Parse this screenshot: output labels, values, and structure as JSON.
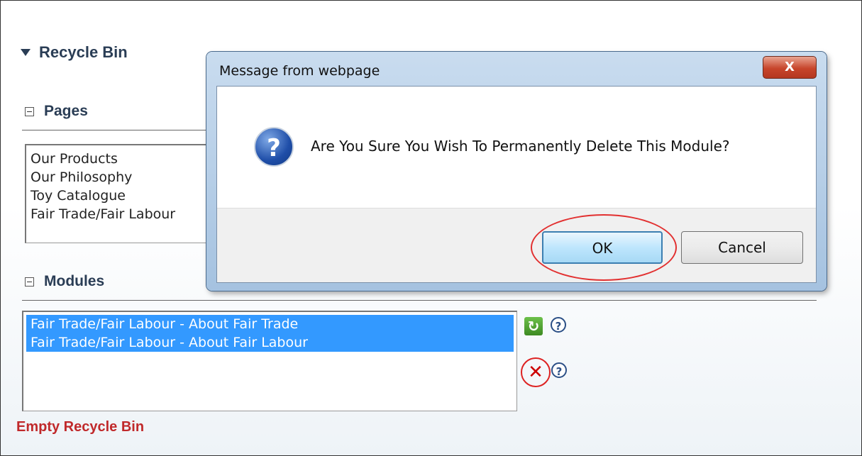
{
  "recycle_bin": {
    "title": "Recycle Bin",
    "pages": {
      "heading": "Pages",
      "items": [
        "Our Products",
        "Our Philosophy",
        "Toy Catalogue",
        "Fair Trade/Fair Labour"
      ]
    },
    "modules": {
      "heading": "Modules",
      "items": [
        {
          "label": "Fair Trade/Fair Labour - About Fair Trade",
          "selected": true
        },
        {
          "label": "Fair Trade/Fair Labour - About Fair Labour",
          "selected": true
        }
      ]
    },
    "empty_link": "Empty Recycle Bin",
    "icons": {
      "restore": "restore-icon",
      "delete": "delete-icon",
      "help": "help-icon",
      "help_glyph": "?",
      "restore_glyph": "↻",
      "delete_glyph": "✕"
    }
  },
  "dialog": {
    "title": "Message from webpage",
    "close_glyph": "X",
    "icon_glyph": "?",
    "message": "Are You Sure You Wish To Permanently Delete This Module?",
    "ok_label": "OK",
    "cancel_label": "Cancel"
  },
  "colors": {
    "link_red": "#c0292b",
    "selection_blue": "#3399ff",
    "heading": "#2a3d55"
  }
}
